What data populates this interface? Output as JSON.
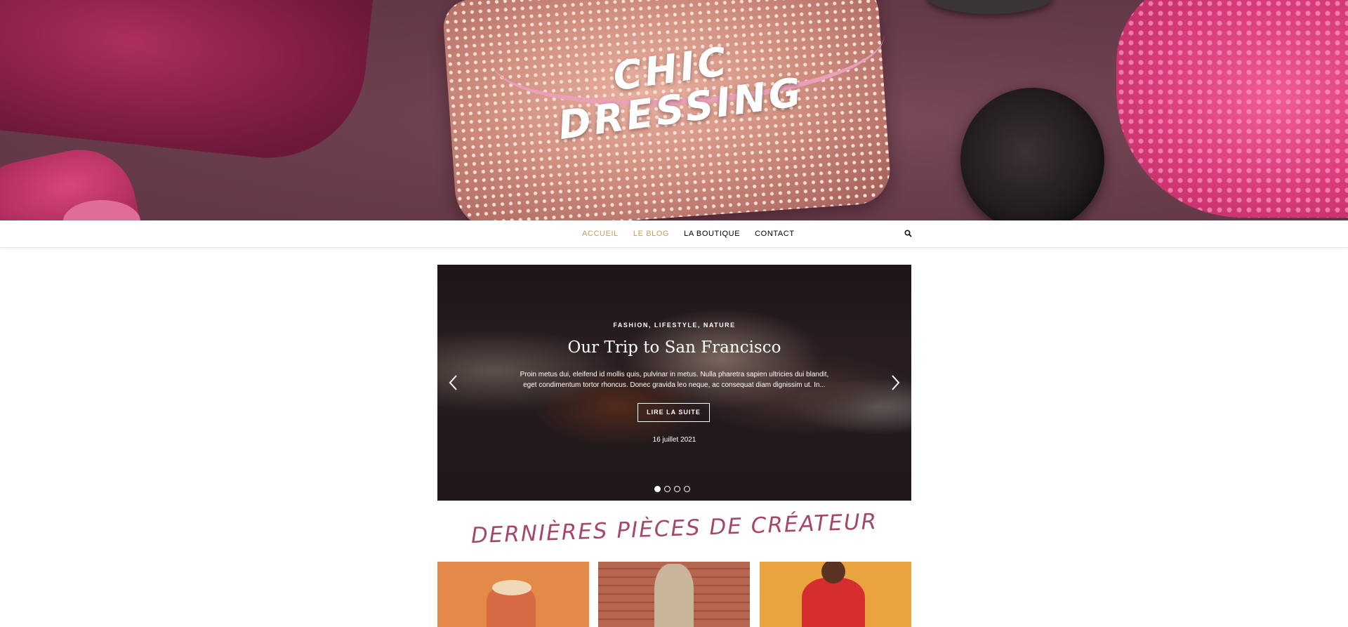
{
  "site": {
    "logo_text": "CHIC DRESSING"
  },
  "nav": {
    "items": [
      {
        "label": "ACCUEIL",
        "active": true
      },
      {
        "label": "LE BLOG",
        "active": true
      },
      {
        "label": "LA BOUTIQUE",
        "active": false
      },
      {
        "label": "CONTACT",
        "active": false
      }
    ],
    "search_icon": "search-icon"
  },
  "slider": {
    "categories": "FASHION, LIFESTYLE, NATURE",
    "title": "Our Trip to San Francisco",
    "excerpt": "Proin metus dui, eleifend id mollis quis, pulvinar in metus. Nulla pharetra sapien ultricies dui blandit, eget condimentum tortor rhoncus. Donec gravida leo neque, ac consequat diam dignissim ut. In...",
    "button_label": "LIRE LA SUITE",
    "date": "16 juillet 2021",
    "total_slides": 4,
    "current_slide": 1,
    "prev_icon": "chevron-left-icon",
    "next_icon": "chevron-right-icon"
  },
  "section": {
    "title": "DERNIÈRES PIÈCES DE CRÉATEUR"
  },
  "colors": {
    "accent_nav": "#c89a5b",
    "section_title": "#a4476b"
  }
}
